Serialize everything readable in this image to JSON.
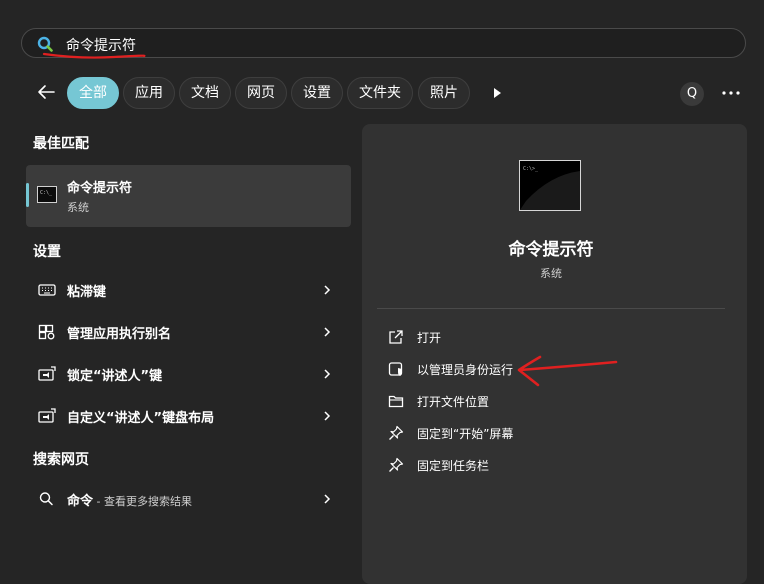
{
  "search": {
    "query": "命令提示符",
    "icon": "search-icon"
  },
  "filters": {
    "items": [
      {
        "label": "全部",
        "active": true
      },
      {
        "label": "应用",
        "active": false
      },
      {
        "label": "文档",
        "active": false
      },
      {
        "label": "网页",
        "active": false
      },
      {
        "label": "设置",
        "active": false
      },
      {
        "label": "文件夹",
        "active": false
      },
      {
        "label": "照片",
        "active": false
      }
    ],
    "account_initial": "Q"
  },
  "best_match": {
    "header": "最佳匹配",
    "title": "命令提示符",
    "subtitle": "系统",
    "icon": "command-prompt-icon"
  },
  "settings": {
    "header": "设置",
    "items": [
      {
        "label": "粘滞键",
        "icon": "keyboard-icon"
      },
      {
        "label": "管理应用执行别名",
        "icon": "app-settings-icon"
      },
      {
        "label": "锁定“讲述人”键",
        "icon": "narrator-icon"
      },
      {
        "label": "自定义“讲述人”键盘布局",
        "icon": "narrator-icon"
      }
    ]
  },
  "web_search": {
    "header": "搜索网页",
    "query": "命令",
    "suffix": " - 查看更多搜索结果"
  },
  "preview": {
    "title": "命令提示符",
    "subtitle": "系统",
    "cmd_prompt_text": "C:\\>_",
    "actions": [
      {
        "label": "打开",
        "icon": "open-external-icon"
      },
      {
        "label": "以管理员身份运行",
        "icon": "shield-run-icon"
      },
      {
        "label": "打开文件位置",
        "icon": "folder-icon"
      },
      {
        "label": "固定到“开始”屏幕",
        "icon": "pin-icon"
      },
      {
        "label": "固定到任务栏",
        "icon": "pin-icon"
      }
    ]
  },
  "colors": {
    "accent": "#76c7d4",
    "background": "#252525",
    "pane": "#323232",
    "annotation": "#e02020"
  }
}
